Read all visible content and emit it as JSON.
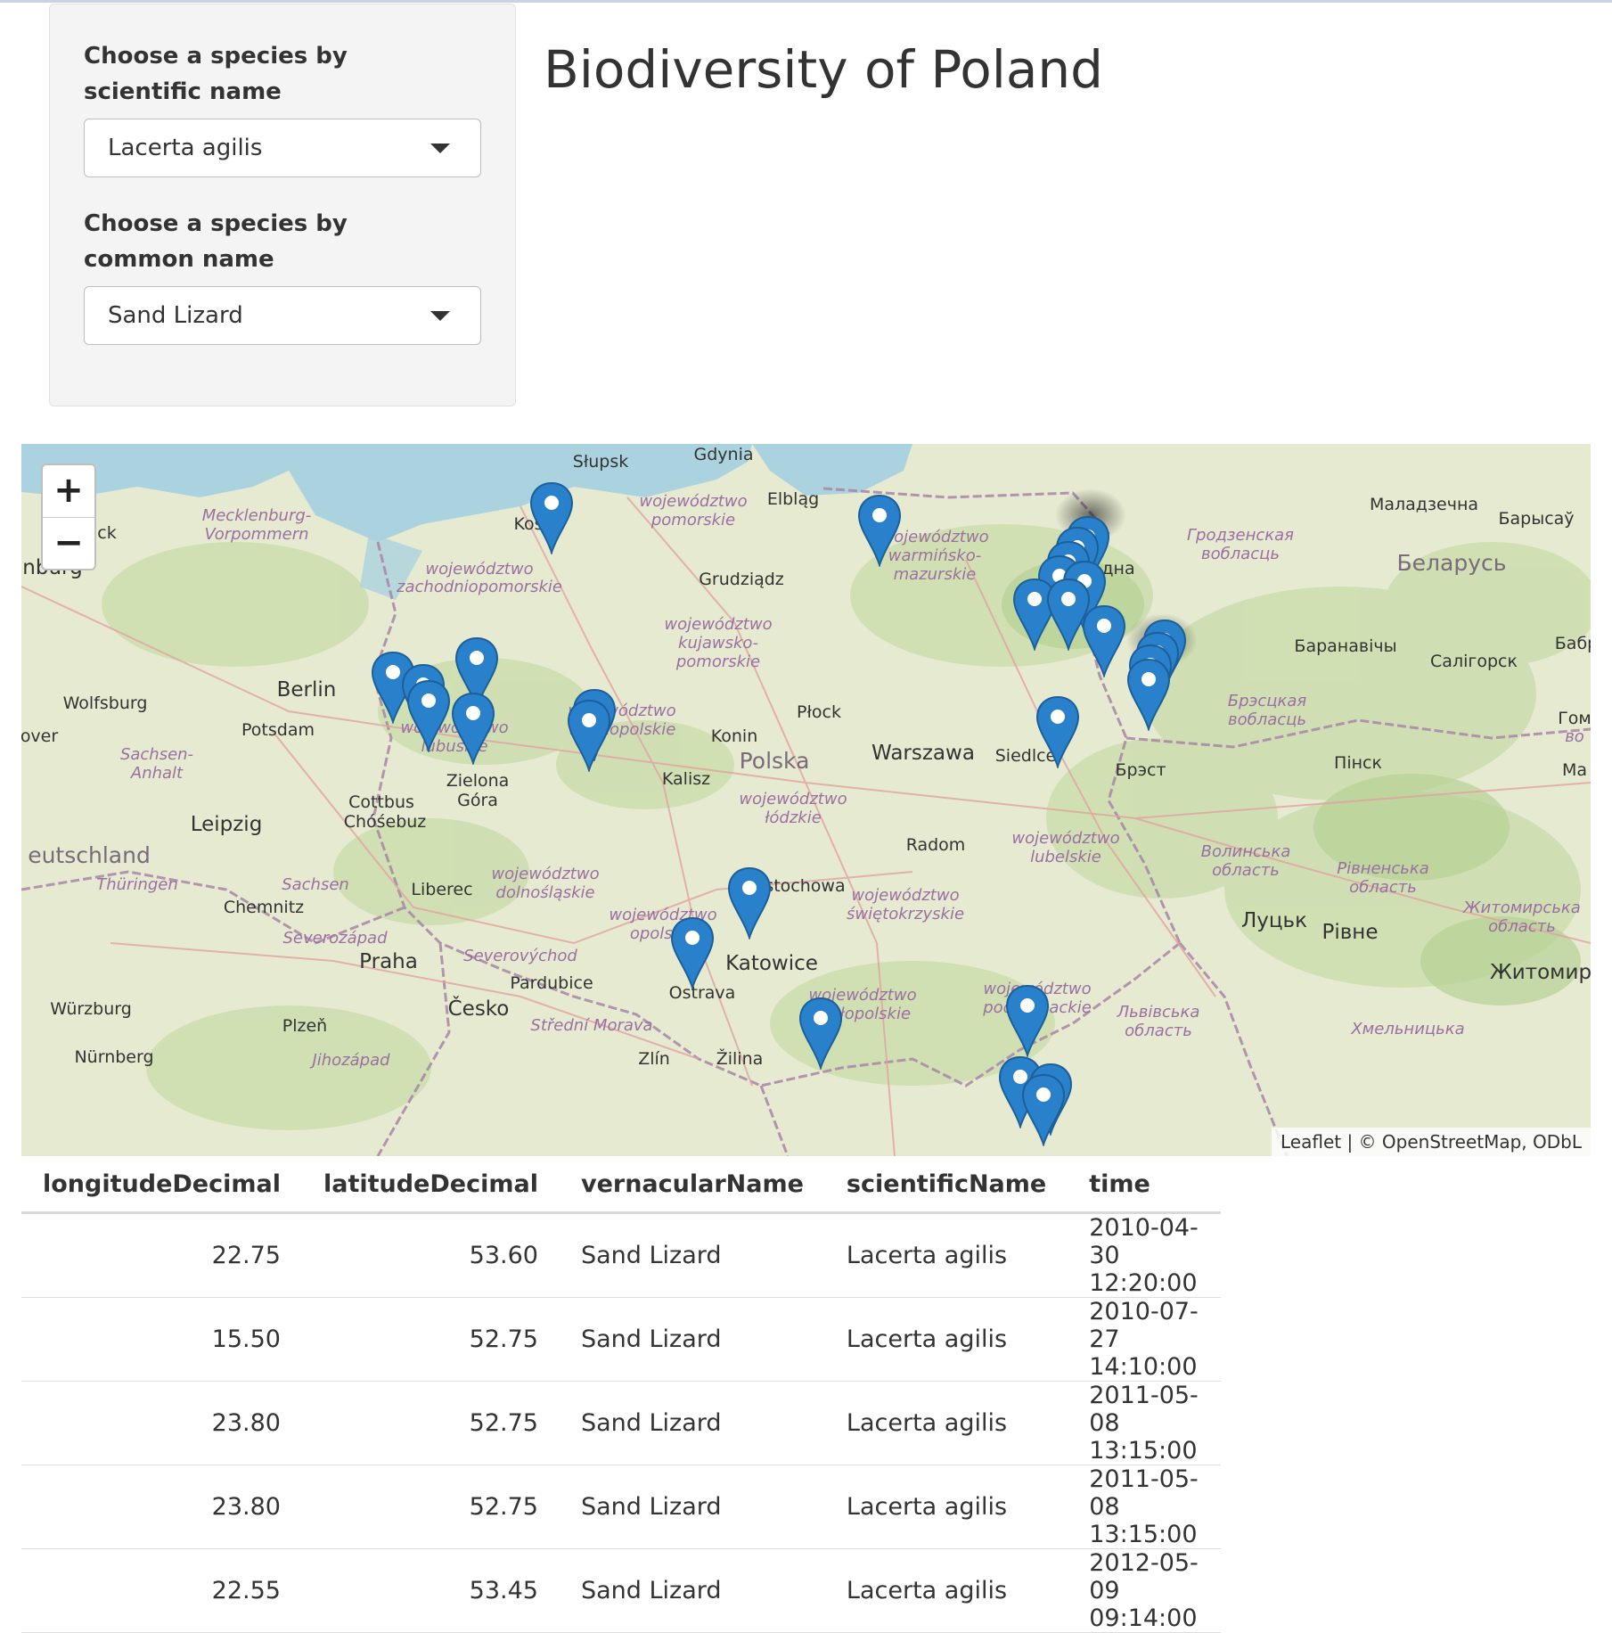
{
  "sidebar": {
    "scientific_label": "Choose a species by scientific name",
    "scientific_value": "Lacerta agilis",
    "common_label": "Choose a species by common name",
    "common_value": "Sand Lizard"
  },
  "page": {
    "title": "Biodiversity of Poland"
  },
  "map": {
    "zoom_in": "+",
    "zoom_out": "−",
    "attribution": "Leaflet | © OpenStreetMap, ODbL",
    "marker_color": "#2a81cb",
    "labels": {
      "slupsk": "Słupsk",
      "gdynia": "Gdynia",
      "elblag": "Elbląg",
      "koszalin": "Kosz",
      "pomorskie1": "województwo",
      "pomorskie2": "pomorskie",
      "mecklenburg1": "Mecklenburg-",
      "mecklenburg2": "Vorpommern",
      "hamburg": "nburg",
      "lubeck": "ck",
      "zachod1": "województwo",
      "zachod2": "zachodniopomorskie",
      "grudziadz": "Grudziądz",
      "warmin1": "województwo",
      "warmin2": "warmińsko-",
      "warmin3": "mazurskie",
      "hrodna": "дна",
      "maladzecna": "Маладзечна",
      "barysau": "Барысаў",
      "hrodz1": "Гродзенская",
      "hrodz2": "вобласць",
      "belarus": "Беларусь",
      "kuj1": "województwo",
      "kuj2": "kujawsko-",
      "kuj3": "pomorskie",
      "baranavichy": "Баранавічы",
      "salihorsk": "Салігорск",
      "babr": "Бабр",
      "berlin": "Berlin",
      "wolfsburg": "Wolfsburg",
      "potsdam": "Potsdam",
      "hanover": "over",
      "plock": "Płock",
      "lubuskie1": "województwo",
      "lubuskie2": "lubuskie",
      "wielk1": "województwo",
      "wielk2": "wielkopolskie",
      "konin": "Konin",
      "polska": "Polska",
      "warszawa": "Warszawa",
      "siedlce": "Siedlce",
      "brest1": "Брэсцкая",
      "brest2": "вобласць",
      "brest": "Брэст",
      "pinsk": "Пінск",
      "gom": "Гом",
      "vo": "во",
      "ma": "Ма",
      "sachsen1": "Sachsen-",
      "sachsen2": "Anhalt",
      "zielona1": "Zielona",
      "zielona2": "Góra",
      "cottbus1": "Cottbus",
      "cottbus2": "Chóśebuz",
      "kalisz": "Kalisz",
      "lodz1": "województwo",
      "lodz2": "łódzkie",
      "leipzig": "Leipzig",
      "deutschland": "eutschland",
      "thuringen": "Thüringen",
      "sachsen": "Sachsen",
      "chemnitz": "Chemnitz",
      "liberec": "Liberec",
      "dolno1": "województwo",
      "dolno2": "dolnośląskie",
      "radom": "Radom",
      "lubel1": "województwo",
      "lubel2": "lubelskie",
      "volyn1": "Волинська",
      "volyn2": "область",
      "rivne1": "Рівненська",
      "rivne2": "область",
      "czest": "Częstochowa",
      "swiet1": "województwo",
      "swiet2": "świętokrzyskie",
      "lutsk": "Луцьк",
      "rivne": "Рівне",
      "zhyt1": "Житомирська",
      "zhyt2": "область",
      "opol1": "województwo",
      "opol2": "opolskie",
      "severozapad": "Severozápad",
      "severovychod": "Severovýchod",
      "praha": "Praha",
      "pardubice": "Pardubice",
      "katowice": "Katowice",
      "ostrava": "Ostrava",
      "malop1": "województwo",
      "malop2": "małopolskie",
      "podk1": "województwo",
      "podk2": "podkarpackie",
      "lviv1": "Львівська",
      "lviv2": "область",
      "zhytomyr": "Житомир",
      "wurzburg": "Würzburg",
      "plzen": "Plzeň",
      "cesko": "Česko",
      "stredni": "Střední Morava",
      "nurnberg": "Nürnberg",
      "jihozapad": "Jihozápad",
      "zlin": "Zlín",
      "zilina": "Žilina",
      "khmel": "Хмельницька"
    }
  },
  "table": {
    "headers": [
      "longitudeDecimal",
      "latitudeDecimal",
      "vernacularName",
      "scientificName",
      "time"
    ],
    "rows": [
      [
        "22.75",
        "53.60",
        "Sand Lizard",
        "Lacerta agilis",
        "2010-04-30 12:20:00"
      ],
      [
        "15.50",
        "52.75",
        "Sand Lizard",
        "Lacerta agilis",
        "2010-07-27 14:10:00"
      ],
      [
        "23.80",
        "52.75",
        "Sand Lizard",
        "Lacerta agilis",
        "2011-05-08 13:15:00"
      ],
      [
        "23.80",
        "52.75",
        "Sand Lizard",
        "Lacerta agilis",
        "2011-05-08 13:15:00"
      ],
      [
        "22.55",
        "53.45",
        "Sand Lizard",
        "Lacerta agilis",
        "2012-05-09 09:14:00"
      ]
    ]
  }
}
